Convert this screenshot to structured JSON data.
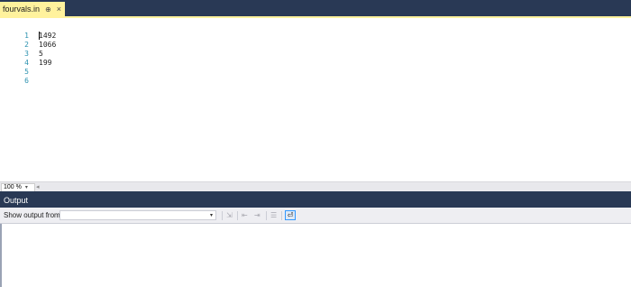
{
  "tab": {
    "filename": "fourvals.in",
    "pin_glyph": "⊕",
    "close_glyph": "×"
  },
  "editor": {
    "line_numbers": [
      "1",
      "2",
      "3",
      "4",
      "5",
      "6"
    ],
    "lines": [
      "1492",
      "1066",
      "5",
      "199",
      "",
      ""
    ]
  },
  "statusbar": {
    "zoom": "100 %"
  },
  "output": {
    "title": "Output",
    "show_from_label": "Show output from:",
    "source_value": ""
  },
  "icons": [
    "dropdown-icon",
    "find-message-icon",
    "prev-message-icon",
    "next-message-icon",
    "clear-all-icon",
    "word-wrap-icon"
  ],
  "colors": {
    "frame": "#293955",
    "active_tab": "#fff29d",
    "line_number": "#2b91af"
  }
}
